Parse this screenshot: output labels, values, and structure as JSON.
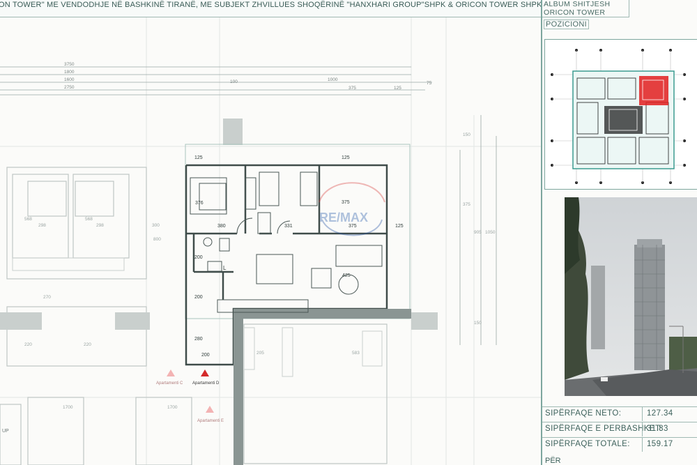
{
  "header": {
    "title": "ON TOWER\" ME VENDODHJE NË BASHKINË TIRANË, ME SUBJEKT ZHVILLUES SHOQËRINË \"HANXHARI GROUP\"SHPK & ORICON TOWER SHPK"
  },
  "sidebar": {
    "album_line1": "ALBUM  SHITJESH",
    "album_line2": "ORICON  TOWER",
    "pozicioni": "POZICIONI",
    "areas": [
      {
        "label": "SIPËRFAQE  NETO:",
        "value": "127.34"
      },
      {
        "label": "SIPËRFAQE  E  PERBASHKET:",
        "value": "31.83"
      },
      {
        "label": "SIPËRFAQE  TOTALE:",
        "value": "159.17"
      }
    ],
    "per": "PËR"
  },
  "plan": {
    "dim_top": [
      "3750",
      "1800",
      "1600",
      "2750",
      "1000",
      "100",
      "375",
      "125",
      "75"
    ],
    "dims_unit": [
      "125",
      "125",
      "376",
      "380",
      "331",
      "375",
      "375",
      "125",
      "200",
      "200",
      "200",
      "280",
      "425",
      "568",
      "298",
      "568",
      "298",
      "300",
      "800",
      "270",
      "220",
      "220",
      "1700",
      "1700",
      "150",
      "375",
      "905",
      "1050",
      "150",
      "205",
      "583"
    ],
    "labels": {
      "apt_c": "Apartamenti C",
      "apt_d": "Apartamenti D",
      "apt_e": "Apartamenti E",
      "up": "UP",
      "watermark": "RE/MAX",
      "l_mark": "L"
    }
  }
}
